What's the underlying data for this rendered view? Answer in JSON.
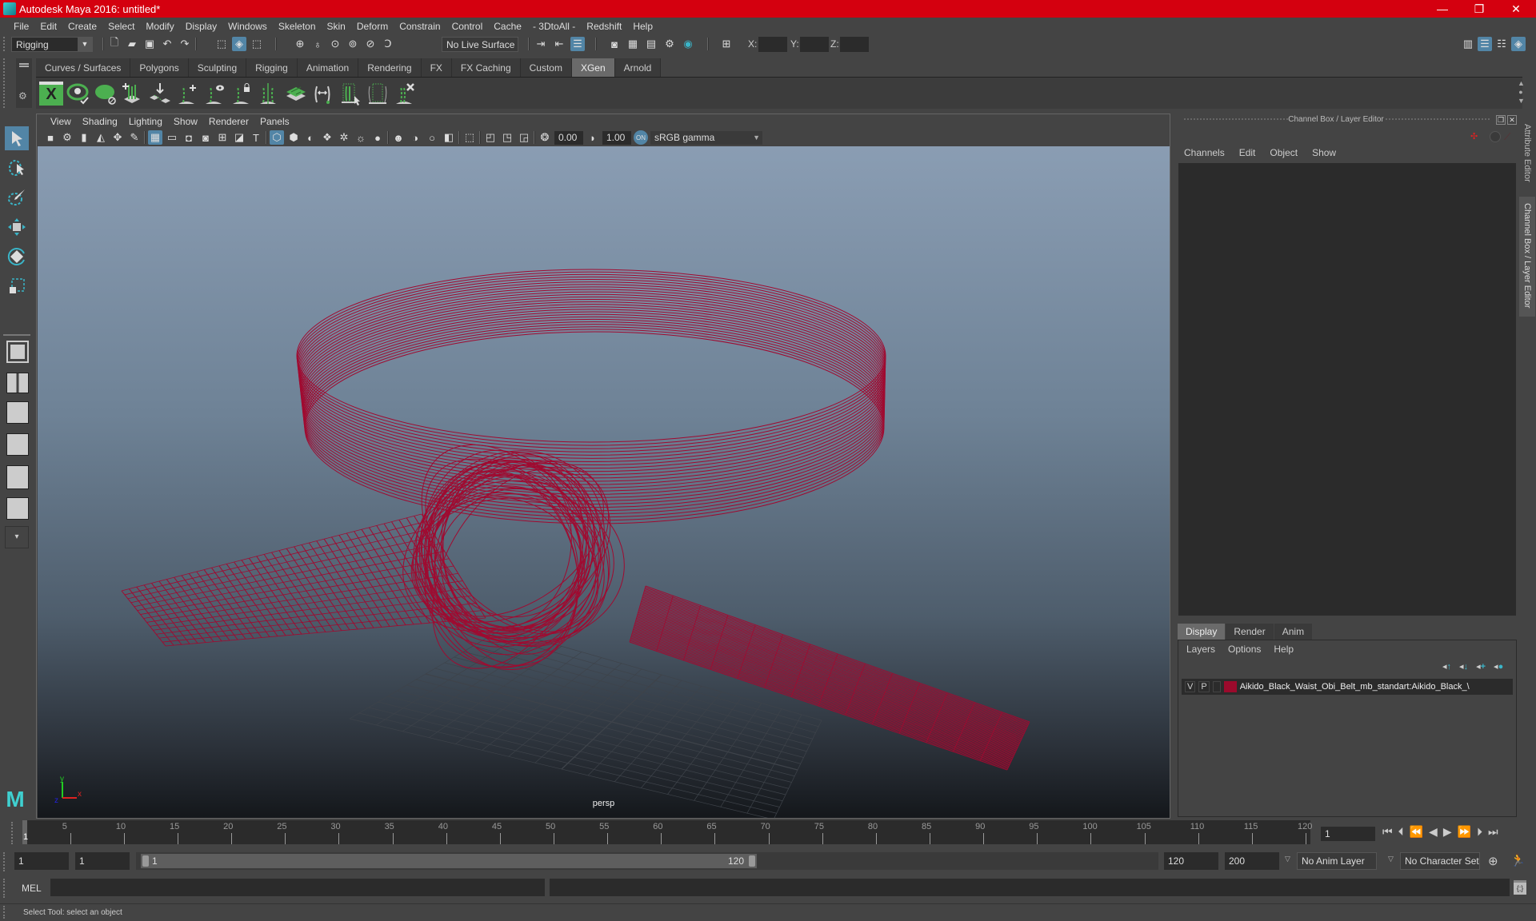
{
  "window": {
    "title": "Autodesk Maya 2016: untitled*",
    "minimize": "—",
    "restore": "❐",
    "close": "✕"
  },
  "menubar": [
    "File",
    "Edit",
    "Create",
    "Select",
    "Modify",
    "Display",
    "Windows",
    "Skeleton",
    "Skin",
    "Deform",
    "Constrain",
    "Control",
    "Cache",
    "- 3DtoAll -",
    "Redshift",
    "Help"
  ],
  "statusline": {
    "menuset": "Rigging",
    "live_surface": "No Live Surface",
    "x_label": "X:",
    "y_label": "Y:",
    "z_label": "Z:",
    "x_value": "",
    "y_value": "",
    "z_value": ""
  },
  "shelf": {
    "tabs": [
      "Curves / Surfaces",
      "Polygons",
      "Sculpting",
      "Rigging",
      "Animation",
      "Rendering",
      "FX",
      "FX Caching",
      "Custom",
      "XGen",
      "Arnold"
    ],
    "active_tab": "XGen",
    "icons": [
      "xgen-editor",
      "xgen-preview",
      "xgen-clear-preview",
      "xgen-create-description",
      "xgen-place-guides",
      "xgen-add-guide",
      "xgen-guide-visibility",
      "xgen-lock-guide",
      "xgen-split-guide",
      "xgen-sculpt-layers",
      "xgen-guide-length",
      "xgen-select-guide",
      "xgen-guide-region",
      "xgen-delete-guide"
    ]
  },
  "viewport": {
    "menus": [
      "View",
      "Shading",
      "Lighting",
      "Show",
      "Renderer",
      "Panels"
    ],
    "exposure": "0.00",
    "gamma": "1.00",
    "color_space": "sRGB gamma",
    "camera_label": "persp",
    "axis": {
      "x": "x",
      "y": "y",
      "z": "z"
    },
    "object_color": "#a00a30"
  },
  "channel_box": {
    "title": "Channel Box / Layer Editor",
    "menus": [
      "Channels",
      "Edit",
      "Object",
      "Show"
    ]
  },
  "layer_editor": {
    "tabs": [
      "Display",
      "Render",
      "Anim"
    ],
    "active_tab": "Display",
    "menus": [
      "Layers",
      "Options",
      "Help"
    ],
    "layers": [
      {
        "visible": "V",
        "playback": "P",
        "color": "#9b0a2c",
        "name": "Aikido_Black_Waist_Obi_Belt_mb_standart:Aikido_Black_\\"
      }
    ]
  },
  "side_tabs": [
    "Attribute Editor",
    "Channel Box / Layer Editor"
  ],
  "timeline": {
    "ticks": [
      "5",
      "10",
      "15",
      "20",
      "25",
      "30",
      "35",
      "40",
      "45",
      "50",
      "55",
      "60",
      "65",
      "70",
      "75",
      "80",
      "85",
      "90",
      "95",
      "100",
      "105",
      "110",
      "115",
      "120"
    ],
    "current_frame_marker": "1",
    "current_frame": "1"
  },
  "range": {
    "start": "1",
    "playback_start": "1",
    "slider_start": "1",
    "slider_end": "120",
    "playback_end": "120",
    "end": "200",
    "anim_layer": "No Anim Layer",
    "character_set": "No Character Set"
  },
  "command_line": {
    "label": "MEL",
    "value": "",
    "result": ""
  },
  "help_line": "Select Tool: select an object"
}
